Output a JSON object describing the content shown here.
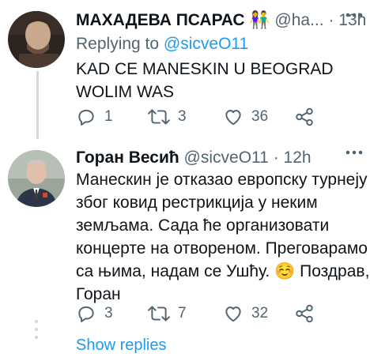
{
  "tweets": [
    {
      "display_name": "МАХАДЕВА ПСАРАС",
      "emoji": "👫",
      "handle": "@ha...",
      "sep": "·",
      "time": "13h",
      "replying_prefix": "Replying to",
      "replying_to": "@sicveO11",
      "lines": [
        "KAD CE MANESKIN U BEOGRAD",
        "WOLIM WAS"
      ],
      "replies": "1",
      "retweets": "3",
      "likes": "36"
    },
    {
      "display_name": "Горан Весић",
      "handle": "@sicveO11",
      "sep": "·",
      "time": "12h",
      "lines": [
        "Манескин је отказао европску турнеју",
        "због ковид рестрикција у неким",
        "земљама. Сада ће организовати",
        "концерте на отвореном. Преговарамо",
        "са њима, надам се Ушћу.",
        "Горан"
      ],
      "line5_emoji": "☺️",
      "line5_tail": "Поздрав,",
      "replies": "3",
      "retweets": "7",
      "likes": "32"
    }
  ],
  "show_replies": "Show replies",
  "icons": {
    "reply": "reply-icon",
    "retweet": "retweet-icon",
    "like": "heart-icon",
    "share": "share-icon",
    "more": "more-icon"
  },
  "colors": {
    "accent": "#1d9bf0",
    "secondary": "#536471",
    "line": "#cfd9de"
  }
}
